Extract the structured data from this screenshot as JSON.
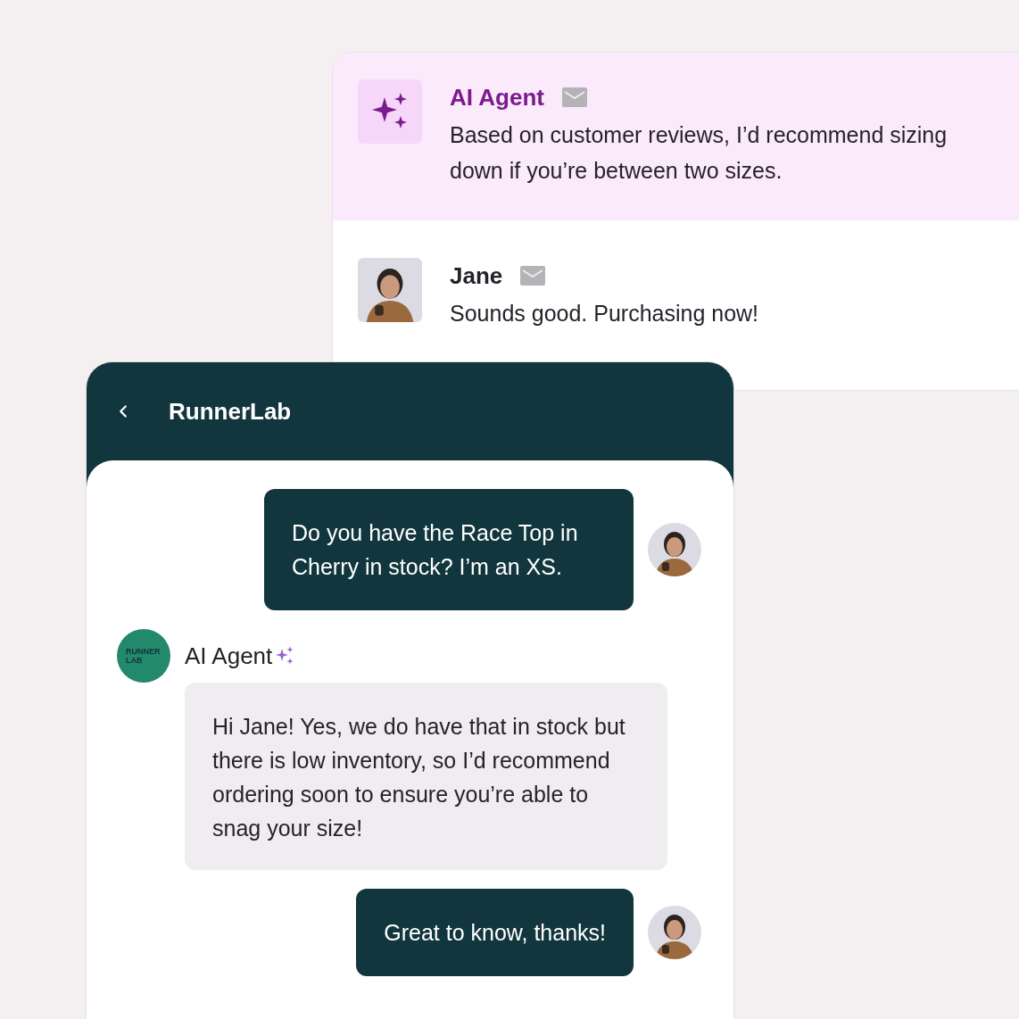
{
  "inbox": {
    "messages": [
      {
        "kind": "agent",
        "sender": "AI Agent",
        "text": "Based on customer reviews, I’d recommend sizing down if you’re between two sizes.",
        "selected": true
      },
      {
        "kind": "customer",
        "sender": "Jane",
        "text": "Sounds good. Purchasing now!",
        "selected": false
      }
    ]
  },
  "chat": {
    "title": "RunnerLab",
    "messages": [
      {
        "kind": "outgoing",
        "text": "Do you have the Race Top in Cherry in stock? I’m an XS."
      },
      {
        "kind": "agent",
        "sender": "AI Agent",
        "logo": [
          "RUNNER",
          "LAB"
        ],
        "text": "Hi Jane! Yes, we do have that in stock but there is low inventory, so I’d recommend ordering soon to ensure you’re able to snag your size!"
      },
      {
        "kind": "outgoing",
        "text": "Great to know, thanks!"
      }
    ]
  }
}
